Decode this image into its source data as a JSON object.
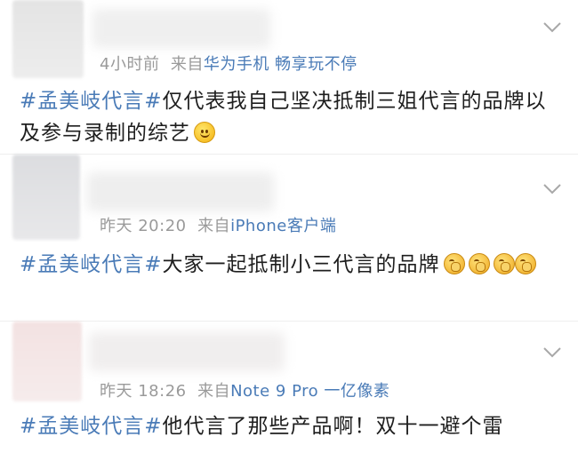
{
  "posts": [
    {
      "time": "4小时前",
      "via": "来自",
      "source": "华为手机 畅享玩不停",
      "hashtag": "#孟美岐代言#",
      "text": "仅代表我自己坚决抵制三姐代言的品牌以及参与录制的综艺",
      "emoji_icons": [
        "smile-icon"
      ]
    },
    {
      "time": "昨天 20:20",
      "via": "来自",
      "source": "iPhone客户端",
      "hashtag": "#孟美岐代言#",
      "text": "大家一起抵制小三代言的品牌",
      "emoji_icons": [
        "clap-icon",
        "clap-icon",
        "clap-icon",
        "clap-icon"
      ]
    },
    {
      "time": "昨天 18:26",
      "via": "来自",
      "source": "Note 9 Pro 一亿像素",
      "hashtag": "#孟美岐代言#",
      "text": "他代言了那些产品啊！双十一避个雷",
      "emoji_icons": []
    }
  ],
  "colors": {
    "link": "#4a7bb7",
    "meta": "#9a9a9a",
    "text": "#1e1e1e"
  }
}
